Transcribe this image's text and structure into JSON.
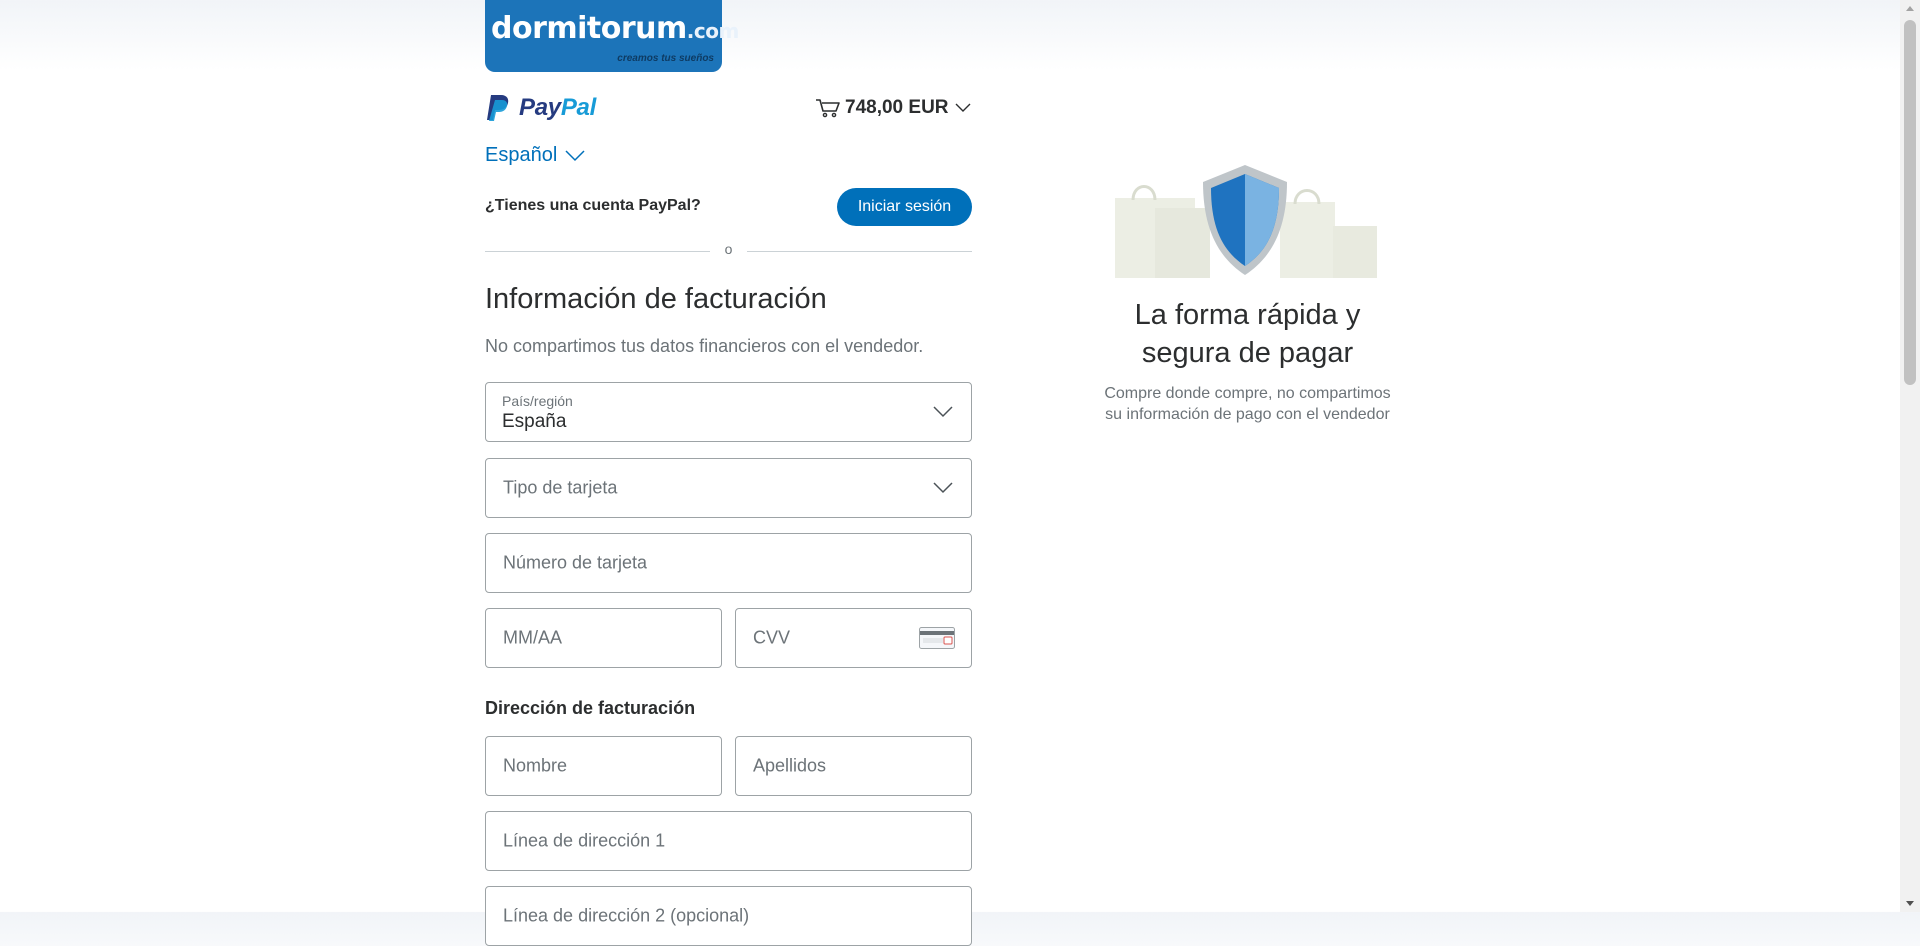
{
  "merchant": {
    "name": "dormitorum",
    "domain": ".com",
    "tagline": "creamos tus sueños"
  },
  "paypal": {
    "brand_part1": "Pay",
    "brand_part2": "Pal"
  },
  "cart": {
    "total": "748,00 EUR"
  },
  "language": {
    "selected": "Español"
  },
  "account": {
    "question": "¿Tienes una cuenta PayPal?",
    "login_label": "Iniciar sesión"
  },
  "divider": {
    "text": "o"
  },
  "billing": {
    "title": "Información de facturación",
    "privacy_note": "No compartimos tus datos financieros con el vendedor.",
    "country_label": "País/región",
    "country_value": "España",
    "card_type_placeholder": "Tipo de tarjeta",
    "card_number_placeholder": "Número de tarjeta",
    "expiry_placeholder": "MM/AA",
    "cvv_placeholder": "CVV"
  },
  "address": {
    "title": "Dirección de facturación",
    "first_name_placeholder": "Nombre",
    "last_name_placeholder": "Apellidos",
    "line1_placeholder": "Línea de dirección 1",
    "line2_placeholder": "Línea de dirección 2 (opcional)"
  },
  "promo": {
    "title_line1": "La forma rápida y",
    "title_line2": "segura de pagar",
    "text_line1": "Compre donde compre, no compartimos",
    "text_line2": "su información de pago con el vendedor"
  },
  "colors": {
    "paypal_blue": "#0070ba",
    "merchant_blue": "#1c74b9",
    "brand_dark": "#253b80",
    "brand_light": "#179bd7"
  }
}
